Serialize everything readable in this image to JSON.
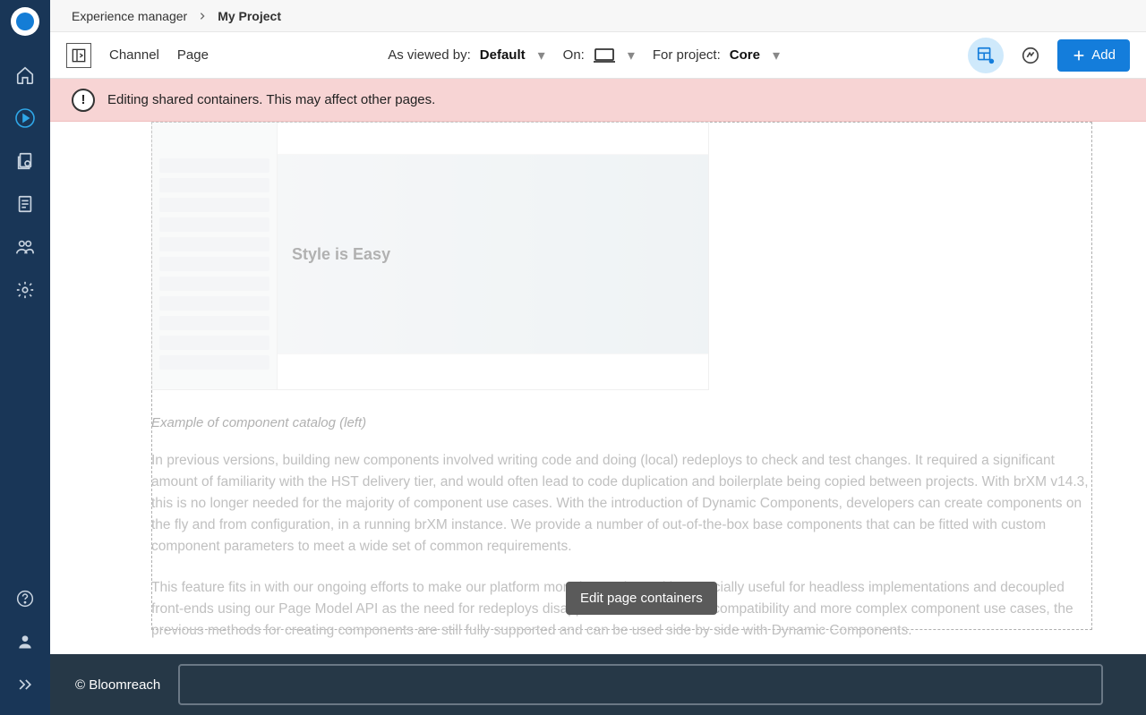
{
  "breadcrumb": {
    "root": "Experience manager",
    "current": "My Project"
  },
  "toolbar": {
    "channel_label": "Channel",
    "page_label": "Page",
    "view_as_label": "As viewed by:",
    "view_as_value": "Default",
    "on_label": "On:",
    "project_label": "For project:",
    "project_value": "Core",
    "add_label": "Add"
  },
  "banner": {
    "message": "Editing shared containers. This may affect other pages."
  },
  "content": {
    "caption": "Example of component catalog (left)",
    "hero_title": "Style is Easy",
    "para1": "In previous versions, building new components involved writing code and doing (local) redeploys to check and test changes. It required a significant amount of familiarity with the HST delivery tier, and would often lead to code duplication and boilerplate being copied between projects. With brXM v14.3, this is no longer needed for the majority of component use cases. With the introduction of Dynamic Components, developers can create components on the fly and from configuration, in a running brXM instance. We provide a number of out-of-the-box base components that can be fitted with custom component parameters to meet a wide set of common requirements.",
    "para2": "This feature fits in with our ongoing efforts to make our platform more low-code, and is especially useful for headless implementations and decoupled front-ends using our Page Model API as the need for redeploys disappears. For backwards compatibility and more complex component use cases, the previous methods for creating components are still fully supported and can be used side by side with Dynamic Components."
  },
  "tooltip": {
    "text": "Edit page containers"
  },
  "footer": {
    "copyright": "© Bloomreach"
  },
  "sidebar_items": [
    {
      "name": "home"
    },
    {
      "name": "experience",
      "active": true
    },
    {
      "name": "projects"
    },
    {
      "name": "documents"
    },
    {
      "name": "audience"
    },
    {
      "name": "settings"
    }
  ]
}
